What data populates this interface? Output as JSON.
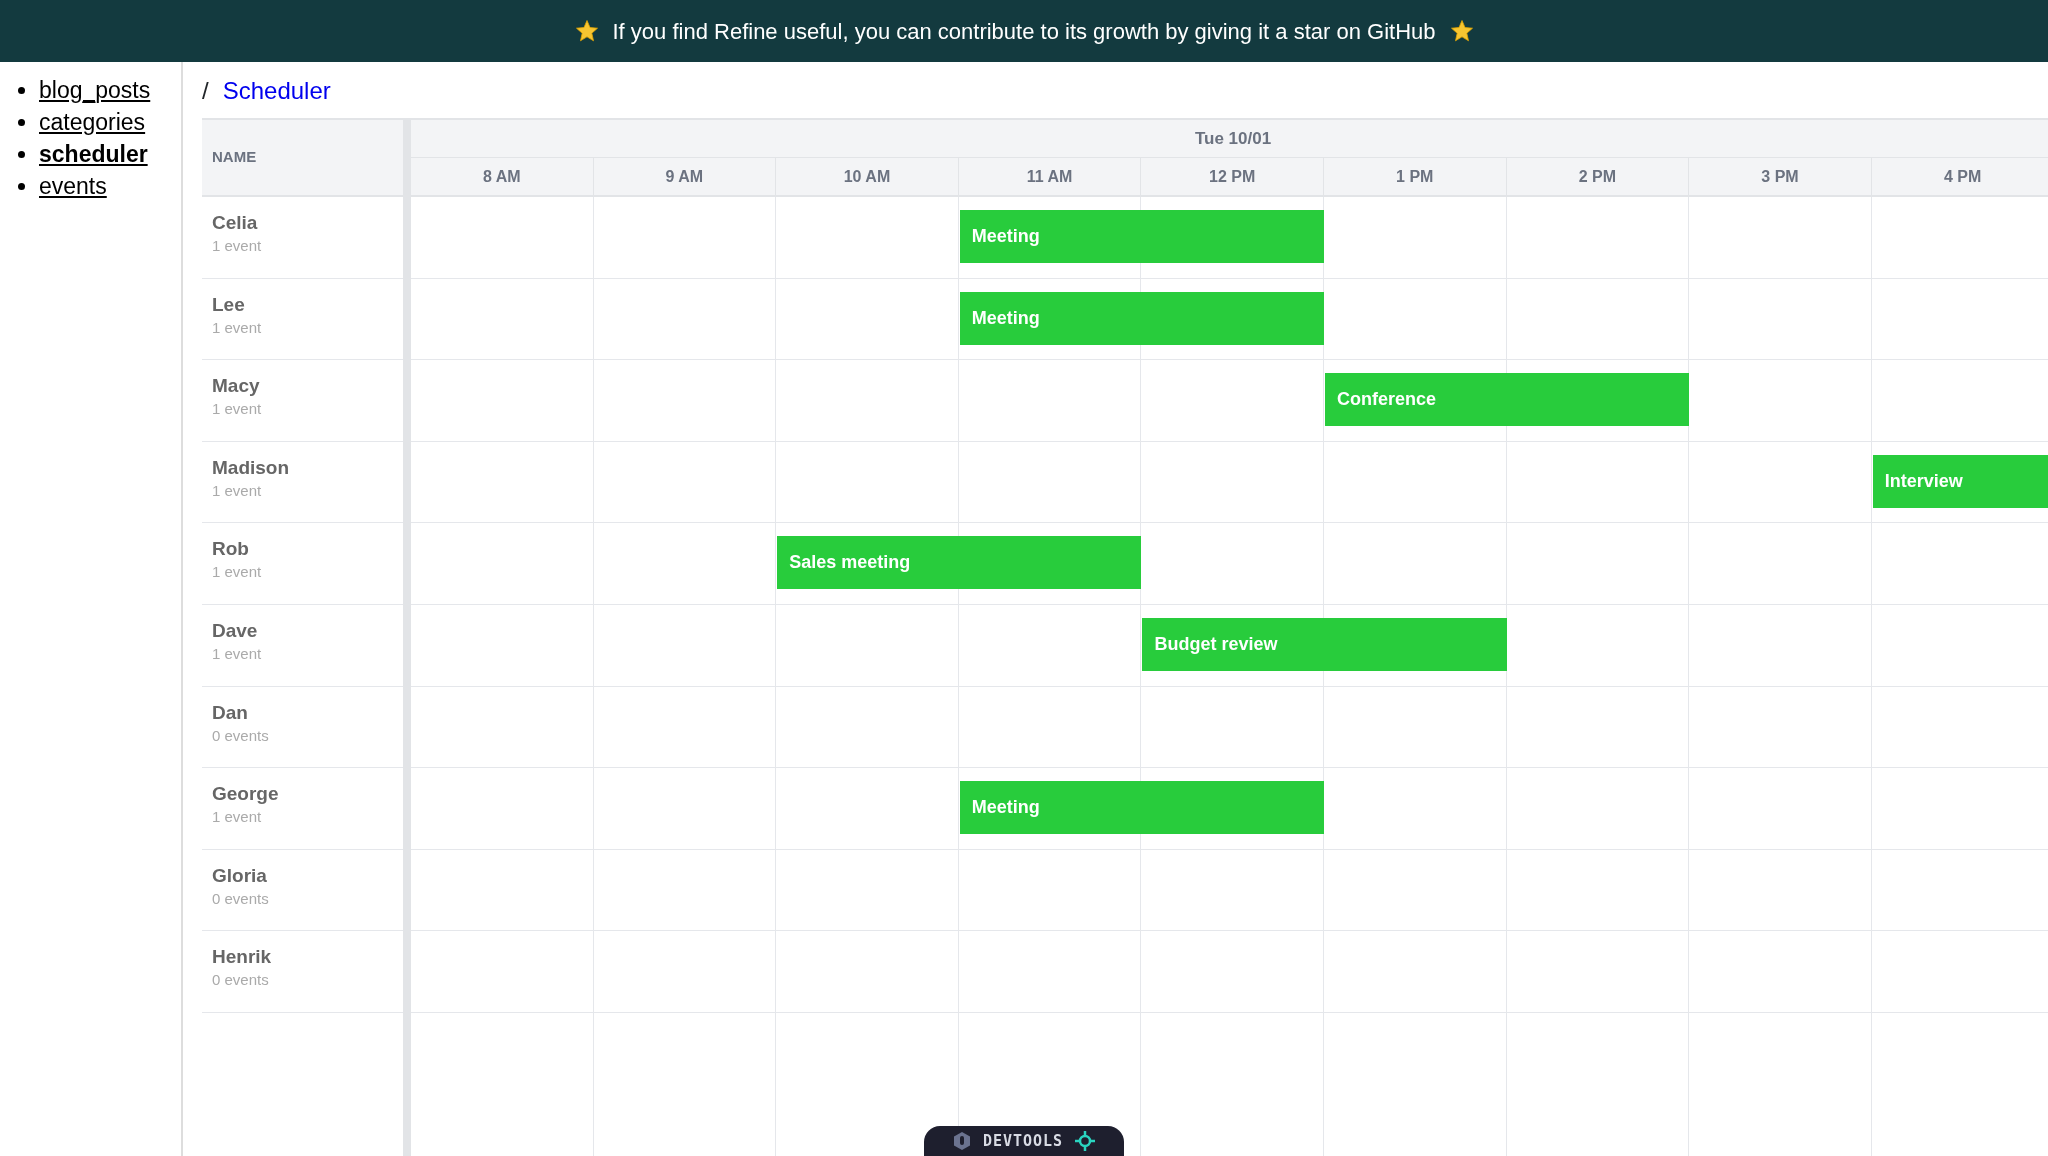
{
  "banner": {
    "text": "If you find Refine useful, you can contribute to its growth by giving it a star on GitHub"
  },
  "sidebar": {
    "items": [
      {
        "label": "blog_posts",
        "selected": false
      },
      {
        "label": "categories",
        "selected": false
      },
      {
        "label": "scheduler",
        "selected": true
      },
      {
        "label": "events",
        "selected": false
      }
    ]
  },
  "breadcrumb": {
    "separator": "/",
    "current": "Scheduler"
  },
  "scheduler": {
    "name_header": "NAME",
    "date": "Tue 10/01",
    "hours": [
      "8 AM",
      "9 AM",
      "10 AM",
      "11 AM",
      "12 PM",
      "1 PM",
      "2 PM",
      "3 PM",
      "4 PM"
    ],
    "rows": [
      {
        "name": "Celia",
        "count": "1 event",
        "slots": [
          {
            "kind": "free"
          },
          {
            "kind": "free"
          },
          {
            "kind": "free"
          },
          {
            "kind": "event",
            "label": "Meeting"
          },
          {
            "kind": "cont"
          },
          {
            "kind": "free"
          },
          {
            "kind": "free"
          },
          {
            "kind": "free"
          },
          {
            "kind": "free"
          }
        ]
      },
      {
        "name": "Lee",
        "count": "1 event",
        "slots": [
          {
            "kind": "free"
          },
          {
            "kind": "free"
          },
          {
            "kind": "free"
          },
          {
            "kind": "event",
            "label": "Meeting"
          },
          {
            "kind": "cont"
          },
          {
            "kind": "free"
          },
          {
            "kind": "free"
          },
          {
            "kind": "free"
          },
          {
            "kind": "free"
          }
        ]
      },
      {
        "name": "Macy",
        "count": "1 event",
        "slots": [
          {
            "kind": "free"
          },
          {
            "kind": "free"
          },
          {
            "kind": "free"
          },
          {
            "kind": "free"
          },
          {
            "kind": "free"
          },
          {
            "kind": "event",
            "label": "Conference"
          },
          {
            "kind": "cont"
          },
          {
            "kind": "free"
          },
          {
            "kind": "free"
          }
        ]
      },
      {
        "name": "Madison",
        "count": "1 event",
        "slots": [
          {
            "kind": "free"
          },
          {
            "kind": "free"
          },
          {
            "kind": "free"
          },
          {
            "kind": "free"
          },
          {
            "kind": "free"
          },
          {
            "kind": "free"
          },
          {
            "kind": "free"
          },
          {
            "kind": "free"
          },
          {
            "kind": "event",
            "label": "Interview"
          }
        ]
      },
      {
        "name": "Rob",
        "count": "1 event",
        "slots": [
          {
            "kind": "free"
          },
          {
            "kind": "free"
          },
          {
            "kind": "event",
            "label": "Sales meeting"
          },
          {
            "kind": "cont"
          },
          {
            "kind": "free"
          },
          {
            "kind": "free"
          },
          {
            "kind": "free"
          },
          {
            "kind": "free"
          },
          {
            "kind": "free"
          }
        ]
      },
      {
        "name": "Dave",
        "count": "1 event",
        "slots": [
          {
            "kind": "free"
          },
          {
            "kind": "free"
          },
          {
            "kind": "free"
          },
          {
            "kind": "free"
          },
          {
            "kind": "event",
            "label": "Budget review"
          },
          {
            "kind": "cont"
          },
          {
            "kind": "free"
          },
          {
            "kind": "free"
          },
          {
            "kind": "free"
          }
        ]
      },
      {
        "name": "Dan",
        "count": "0 events",
        "slots": [
          {
            "kind": "free"
          },
          {
            "kind": "free"
          },
          {
            "kind": "free"
          },
          {
            "kind": "free"
          },
          {
            "kind": "free"
          },
          {
            "kind": "free"
          },
          {
            "kind": "free"
          },
          {
            "kind": "free"
          },
          {
            "kind": "free"
          }
        ]
      },
      {
        "name": "George",
        "count": "1 event",
        "slots": [
          {
            "kind": "free"
          },
          {
            "kind": "free"
          },
          {
            "kind": "free"
          },
          {
            "kind": "event",
            "label": "Meeting"
          },
          {
            "kind": "cont"
          },
          {
            "kind": "free"
          },
          {
            "kind": "free"
          },
          {
            "kind": "free"
          },
          {
            "kind": "free"
          }
        ]
      },
      {
        "name": "Gloria",
        "count": "0 events",
        "slots": [
          {
            "kind": "free"
          },
          {
            "kind": "free"
          },
          {
            "kind": "free"
          },
          {
            "kind": "free"
          },
          {
            "kind": "free"
          },
          {
            "kind": "free"
          },
          {
            "kind": "free"
          },
          {
            "kind": "free"
          },
          {
            "kind": "free"
          }
        ]
      },
      {
        "name": "Henrik",
        "count": "0 events",
        "slots": [
          {
            "kind": "free"
          },
          {
            "kind": "free"
          },
          {
            "kind": "free"
          },
          {
            "kind": "free"
          },
          {
            "kind": "free"
          },
          {
            "kind": "free"
          },
          {
            "kind": "free"
          },
          {
            "kind": "free"
          },
          {
            "kind": "free"
          }
        ]
      }
    ]
  },
  "devtools": {
    "label": "DEVTOOLS"
  }
}
